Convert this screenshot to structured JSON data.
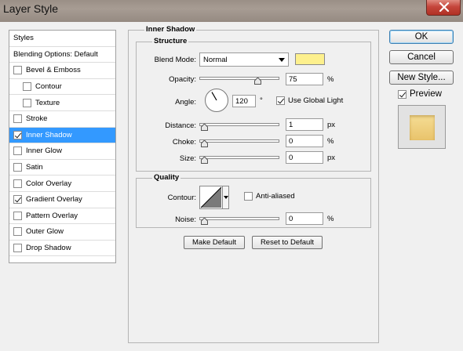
{
  "window": {
    "title": "Layer Style"
  },
  "styles_list": {
    "header": "Styles",
    "items": [
      {
        "label": "Blending Options: Default",
        "checkbox": false,
        "checked": false,
        "indent": false,
        "selected": false
      },
      {
        "label": "Bevel & Emboss",
        "checkbox": true,
        "checked": false,
        "indent": false,
        "selected": false
      },
      {
        "label": "Contour",
        "checkbox": true,
        "checked": false,
        "indent": true,
        "selected": false
      },
      {
        "label": "Texture",
        "checkbox": true,
        "checked": false,
        "indent": true,
        "selected": false
      },
      {
        "label": "Stroke",
        "checkbox": true,
        "checked": false,
        "indent": false,
        "selected": false
      },
      {
        "label": "Inner Shadow",
        "checkbox": true,
        "checked": true,
        "indent": false,
        "selected": true
      },
      {
        "label": "Inner Glow",
        "checkbox": true,
        "checked": false,
        "indent": false,
        "selected": false
      },
      {
        "label": "Satin",
        "checkbox": true,
        "checked": false,
        "indent": false,
        "selected": false
      },
      {
        "label": "Color Overlay",
        "checkbox": true,
        "checked": false,
        "indent": false,
        "selected": false
      },
      {
        "label": "Gradient Overlay",
        "checkbox": true,
        "checked": true,
        "indent": false,
        "selected": false
      },
      {
        "label": "Pattern Overlay",
        "checkbox": true,
        "checked": false,
        "indent": false,
        "selected": false
      },
      {
        "label": "Outer Glow",
        "checkbox": true,
        "checked": false,
        "indent": false,
        "selected": false
      },
      {
        "label": "Drop Shadow",
        "checkbox": true,
        "checked": false,
        "indent": false,
        "selected": false
      }
    ]
  },
  "inner_shadow": {
    "panel_title": "Inner Shadow",
    "structure": {
      "title": "Structure",
      "blend_mode_label": "Blend Mode:",
      "blend_mode_value": "Normal",
      "shadow_color": "#fdf08d",
      "opacity_label": "Opacity:",
      "opacity_value": "75",
      "opacity_unit": "%",
      "opacity_fraction": 0.75,
      "angle_label": "Angle:",
      "angle_value": "120",
      "angle_unit": "°",
      "angle_degrees": 120,
      "use_global_light_label": "Use Global Light",
      "use_global_light_checked": true,
      "distance_label": "Distance:",
      "distance_value": "1",
      "distance_unit": "px",
      "choke_label": "Choke:",
      "choke_value": "0",
      "choke_unit": "%",
      "size_label": "Size:",
      "size_value": "0",
      "size_unit": "px"
    },
    "quality": {
      "title": "Quality",
      "contour_label": "Contour:",
      "anti_aliased_label": "Anti-aliased",
      "anti_aliased_checked": false,
      "noise_label": "Noise:",
      "noise_value": "0",
      "noise_unit": "%"
    },
    "make_default_label": "Make Default",
    "reset_default_label": "Reset to Default"
  },
  "buttons": {
    "ok_label": "OK",
    "cancel_label": "Cancel",
    "new_style_label": "New Style...",
    "preview_label": "Preview",
    "preview_checked": true
  }
}
